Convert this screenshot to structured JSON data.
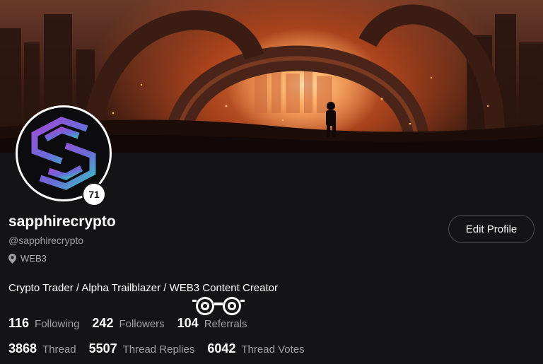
{
  "banner": {
    "description_icon": "post-apocalyptic-arch-banner"
  },
  "avatar": {
    "icon": "sapphire-s-logo-icon",
    "level": "71"
  },
  "profile": {
    "username": "sapphirecrypto",
    "handle": "@sapphirecrypto",
    "location": "WEB3",
    "bio": "Crypto Trader / Alpha Trailblazer / WEB3 Content Creator"
  },
  "actions": {
    "edit_profile_label": "Edit Profile"
  },
  "stats_row1": [
    {
      "value": "116",
      "label": "Following"
    },
    {
      "value": "242",
      "label": "Followers"
    },
    {
      "value": "104",
      "label": "Referrals"
    }
  ],
  "stats_row2": [
    {
      "value": "3868",
      "label": "Thread"
    },
    {
      "value": "5507",
      "label": "Thread Replies"
    },
    {
      "value": "6042",
      "label": "Thread Votes"
    }
  ],
  "colors": {
    "background": "#141416",
    "muted_text": "#a0a0a6",
    "banner_glow": "#ffb26b",
    "logo_gradient_start": "#a24bd6",
    "logo_gradient_end": "#35c6c0"
  }
}
